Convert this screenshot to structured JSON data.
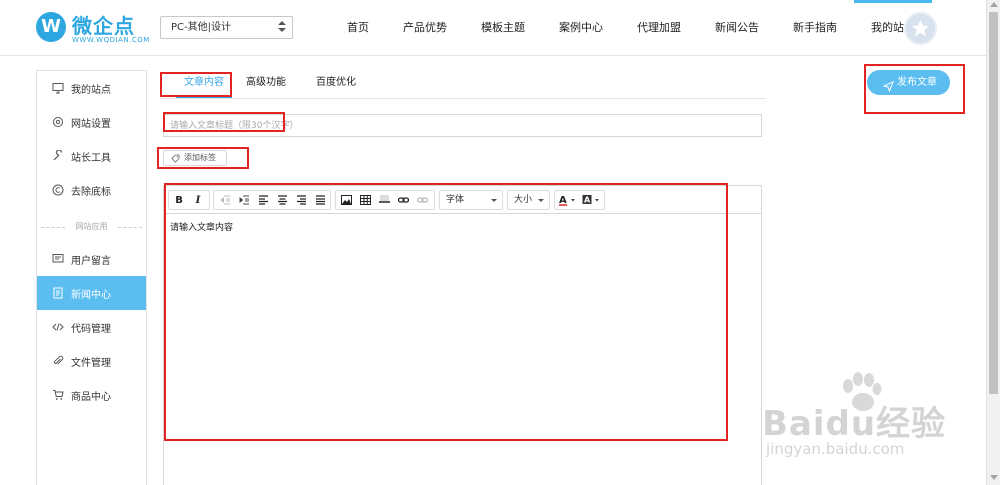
{
  "header": {
    "logo_text": "微企点",
    "logo_sub": "WWW.WQDIAN.COM",
    "site_select": "PC-其他|设计",
    "nav": [
      "首页",
      "产品优势",
      "模板主题",
      "案例中心",
      "代理加盟",
      "新闻公告",
      "新手指南",
      "我的站点"
    ],
    "active_nav": "我的站点"
  },
  "sidebar": {
    "items": [
      {
        "label": "我的站点",
        "icon": "monitor-icon"
      },
      {
        "label": "网站设置",
        "icon": "gear-icon"
      },
      {
        "label": "站长工具",
        "icon": "wrench-icon"
      },
      {
        "label": "去除底标",
        "icon": "copyright-icon"
      }
    ],
    "group_label": "网站应用",
    "app_items": [
      {
        "label": "用户留言",
        "icon": "message-icon"
      },
      {
        "label": "新闻中心",
        "icon": "document-icon",
        "active": true
      },
      {
        "label": "代码管理",
        "icon": "code-icon"
      },
      {
        "label": "文件管理",
        "icon": "paperclip-icon"
      },
      {
        "label": "商品中心",
        "icon": "cart-icon"
      }
    ]
  },
  "tabs": [
    "文章内容",
    "高级功能",
    "百度优化"
  ],
  "publish_label": "发布文章",
  "title_placeholder": "请输入文章标题（限30个汉字）",
  "tag_label": "添加标签",
  "editor": {
    "font_label": "字体",
    "size_label": "大小",
    "content": "请输入文章内容"
  },
  "watermark": {
    "text": "Baidu经验",
    "url": "jingyan.baidu.com"
  },
  "colors": {
    "accent": "#5bbdf0",
    "highlight": "#e02424"
  }
}
